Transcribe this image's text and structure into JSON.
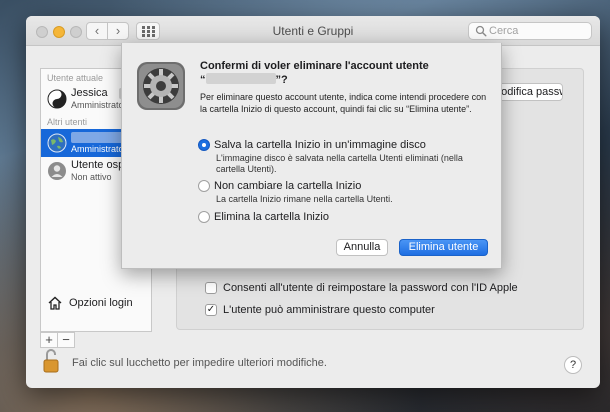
{
  "window": {
    "title": "Utenti e Gruppi",
    "search_placeholder": "Cerca"
  },
  "sidebar": {
    "current_user_label": "Utente attuale",
    "current_user": {
      "name": "Jessica",
      "role": "Amministratore"
    },
    "other_users_label": "Altri utenti",
    "other_users": [
      {
        "name": "",
        "role": "Amministratore",
        "selected": true
      },
      {
        "name": "Utente ospite",
        "role": "Non attivo",
        "selected": false
      }
    ],
    "login_options_label": "Opzioni login",
    "add_label": "+",
    "remove_label": "−"
  },
  "main": {
    "change_password_label": "Modifica password...",
    "checkboxes": [
      {
        "label": "Consenti all'utente di reimpostare la password con l'ID Apple",
        "checked": false
      },
      {
        "label": "L'utente può amministrare questo computer",
        "checked": true
      }
    ]
  },
  "lock": {
    "text": "Fai clic sul lucchetto per impedire ulteriori modifiche."
  },
  "help_label": "?",
  "dialog": {
    "title_line1": "Confermi di voler eliminare l'account utente",
    "title_line2_prefix": "“",
    "title_line2_suffix": "”?",
    "description": "Per eliminare questo account utente, indica come intendi procedere con la cartella Inizio di questo account, quindi fai clic su “Elimina utente”.",
    "options": [
      {
        "label": "Salva la cartella Inizio in un'immagine disco",
        "help": "L'immagine disco è salvata nella cartella Utenti eliminati (nella cartella Utenti).",
        "selected": true
      },
      {
        "label": "Non cambiare la cartella Inizio",
        "help": "La cartella Inizio rimane nella cartella Utenti.",
        "selected": false
      },
      {
        "label": "Elimina la cartella Inizio",
        "help": "",
        "selected": false
      }
    ],
    "cancel_label": "Annulla",
    "delete_label": "Elimina utente"
  }
}
